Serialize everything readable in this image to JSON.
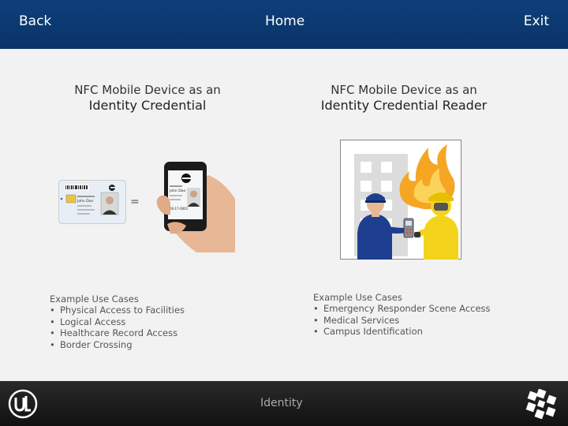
{
  "nav": {
    "back": "Back",
    "home": "Home",
    "exit": "Exit"
  },
  "left_heading": {
    "line1": "NFC Mobile Device as an",
    "line2": "Identity Credential"
  },
  "right_heading": {
    "line1": "NFC Mobile Device as an",
    "line2": "Identity Credential Reader"
  },
  "equals_sign": "=",
  "card_text": {
    "name": "John Doe",
    "phone_name": "John Doe",
    "id": "00-17-0001"
  },
  "left_uses": {
    "title": "Example Use Cases",
    "items": [
      "Physical Access to Facilities",
      "Logical Access",
      "Healthcare Record Access",
      "Border Crossing"
    ]
  },
  "right_uses": {
    "title": "Example Use Cases",
    "items": [
      "Emergency Responder Scene Access",
      "Medical Services",
      "Campus Identification"
    ]
  },
  "footer": {
    "label": "Identity"
  },
  "colors": {
    "top_bar": "#0e3f7a",
    "footer": "#1a1a1a",
    "background": "#f2f2f2"
  }
}
